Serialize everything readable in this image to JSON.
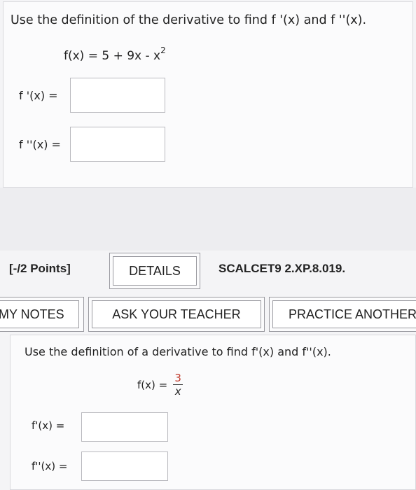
{
  "question1": {
    "prompt": "Use the definition of the derivative to find f '(x) and f ''(x).",
    "function": "f(x) = 5 + 9x - x",
    "exponent": "2",
    "first_label": "f '(x) =",
    "second_label": "f ''(x) ="
  },
  "meta": {
    "points": "[-/2 Points]",
    "details_label": "DETAILS",
    "code": "SCALCET9 2.XP.8.019."
  },
  "tools": {
    "notes_label": "MY NOTES",
    "teacher_label": "ASK YOUR TEACHER",
    "practice_label": "PRACTICE ANOTHER"
  },
  "question2": {
    "prompt": "Use the definition of a derivative to find f'(x) and f''(x).",
    "function_lhs": "f(x) =",
    "numerator": "3",
    "denominator": "x",
    "first_label": "f'(x) =",
    "second_label": "f''(x) ="
  }
}
